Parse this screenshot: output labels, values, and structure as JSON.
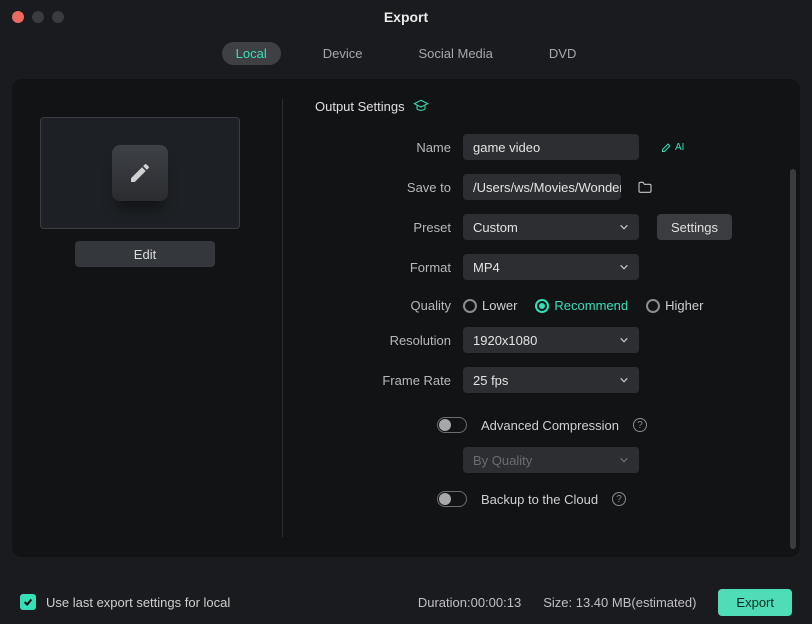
{
  "window": {
    "title": "Export"
  },
  "tabs": [
    {
      "label": "Local",
      "active": true
    },
    {
      "label": "Device",
      "active": false
    },
    {
      "label": "Social Media",
      "active": false
    },
    {
      "label": "DVD",
      "active": false
    }
  ],
  "left": {
    "edit_label": "Edit"
  },
  "section": {
    "title": "Output Settings"
  },
  "fields": {
    "name_label": "Name",
    "name_value": "game video",
    "ai_label": "AI",
    "saveto_label": "Save to",
    "saveto_value": "/Users/ws/Movies/Wonder",
    "preset_label": "Preset",
    "preset_value": "Custom",
    "settings_label": "Settings",
    "format_label": "Format",
    "format_value": "MP4",
    "quality_label": "Quality",
    "quality_options": {
      "lower": "Lower",
      "recommend": "Recommend",
      "higher": "Higher"
    },
    "quality_selected": "recommend",
    "resolution_label": "Resolution",
    "resolution_value": "1920x1080",
    "framerate_label": "Frame Rate",
    "framerate_value": "25 fps",
    "adv_label": "Advanced Compression",
    "adv_mode_value": "By Quality",
    "backup_label": "Backup to the Cloud"
  },
  "footer": {
    "uselast_label": "Use last export settings for local",
    "duration_label": "Duration:",
    "duration_value": "00:00:13",
    "size_label": "Size:",
    "size_value": "13.40 MB",
    "size_suffix": "(estimated)",
    "export_label": "Export"
  }
}
